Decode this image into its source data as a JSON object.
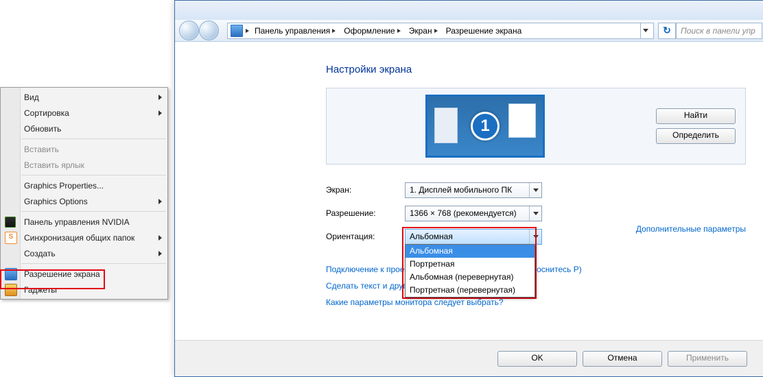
{
  "context_menu": {
    "items": [
      {
        "label": "Вид",
        "submenu": true,
        "icon": null,
        "enabled": true
      },
      {
        "label": "Сортировка",
        "submenu": true,
        "icon": null,
        "enabled": true
      },
      {
        "label": "Обновить",
        "submenu": false,
        "icon": null,
        "enabled": true
      },
      {
        "sep": true
      },
      {
        "label": "Вставить",
        "submenu": false,
        "icon": null,
        "enabled": false
      },
      {
        "label": "Вставить ярлык",
        "submenu": false,
        "icon": null,
        "enabled": false
      },
      {
        "sep": true
      },
      {
        "label": "Graphics Properties...",
        "submenu": false,
        "icon": null,
        "enabled": true
      },
      {
        "label": "Graphics Options",
        "submenu": true,
        "icon": null,
        "enabled": true
      },
      {
        "sep": true
      },
      {
        "label": "Панель управления NVIDIA",
        "submenu": false,
        "icon": "nv",
        "enabled": true
      },
      {
        "label": "Синхронизация общих папок",
        "submenu": true,
        "icon": "sy",
        "icon_text": "S",
        "enabled": true
      },
      {
        "label": "Создать",
        "submenu": true,
        "icon": null,
        "enabled": true
      },
      {
        "sep": true
      },
      {
        "label": "Разрешение экрана",
        "submenu": false,
        "icon": "disp",
        "enabled": true,
        "highlighted": true
      },
      {
        "label": "Гаджеты",
        "submenu": false,
        "icon": "gad",
        "enabled": true
      }
    ]
  },
  "window": {
    "breadcrumb": [
      "Панель управления",
      "Оформление",
      "Экран",
      "Разрешение экрана"
    ],
    "search_placeholder": "Поиск в панели упр",
    "refresh_glyph": "↻",
    "heading": "Настройки экрана",
    "monitor_number": "1",
    "buttons_side": {
      "find": "Найти",
      "detect": "Определить"
    },
    "fields": {
      "display": {
        "label": "Экран:",
        "value": "1. Дисплей мобильного ПК"
      },
      "resolution": {
        "label": "Разрешение:",
        "value": "1366 × 768 (рекомендуется)"
      },
      "orientation": {
        "label": "Ориентация:",
        "value": "Альбомная",
        "options": [
          "Альбомная",
          "Портретная",
          "Альбомная (перевернутая)",
          "Портретная (перевернутая)"
        ],
        "selected_index": 0
      }
    },
    "extra_link": "Дополнительные параметры",
    "links": [
      "Подключение к проектору (или нажмите клавишу ⊞ и коснитесь P)",
      "Сделать текст и другие элементы больше или меньше",
      "Какие параметры монитора следует выбрать?"
    ],
    "footer": {
      "ok": "OK",
      "cancel": "Отмена",
      "apply": "Применить"
    }
  }
}
